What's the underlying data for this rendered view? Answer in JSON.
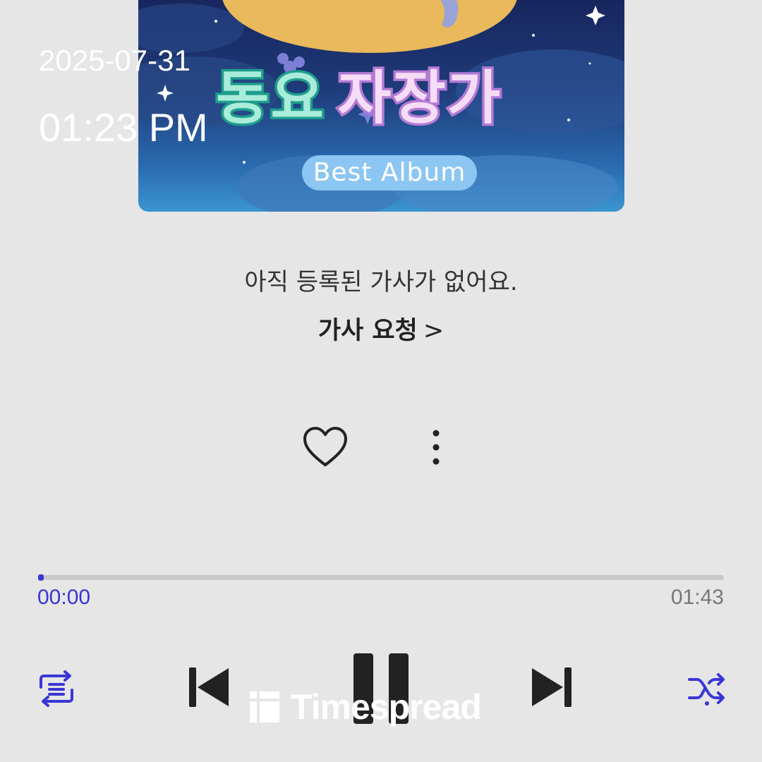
{
  "album": {
    "title_part1": "동요",
    "title_part2": "자장가",
    "badge": "Best Album"
  },
  "overlay": {
    "date": "2025-07-31",
    "time": "01:23 PM"
  },
  "lyrics": {
    "empty_message": "아직 등록된 가사가 없어요.",
    "request_label": "가사 요청",
    "request_chevron": ">"
  },
  "actions": {
    "like_icon": "heart-outline-icon",
    "more_icon": "vertical-dots-icon"
  },
  "progress": {
    "current": "00:00",
    "total": "01:43",
    "fraction": 0.004
  },
  "controls": {
    "repeat_icon": "repeat-list-icon",
    "prev_icon": "skip-previous-icon",
    "play_state_icon": "pause-icon",
    "next_icon": "skip-next-icon",
    "shuffle_icon": "shuffle-icon"
  },
  "watermark": {
    "text": "Timespread"
  },
  "colors": {
    "accent": "#3a35d6",
    "background": "#e6e6e6",
    "controls": "#222222"
  }
}
